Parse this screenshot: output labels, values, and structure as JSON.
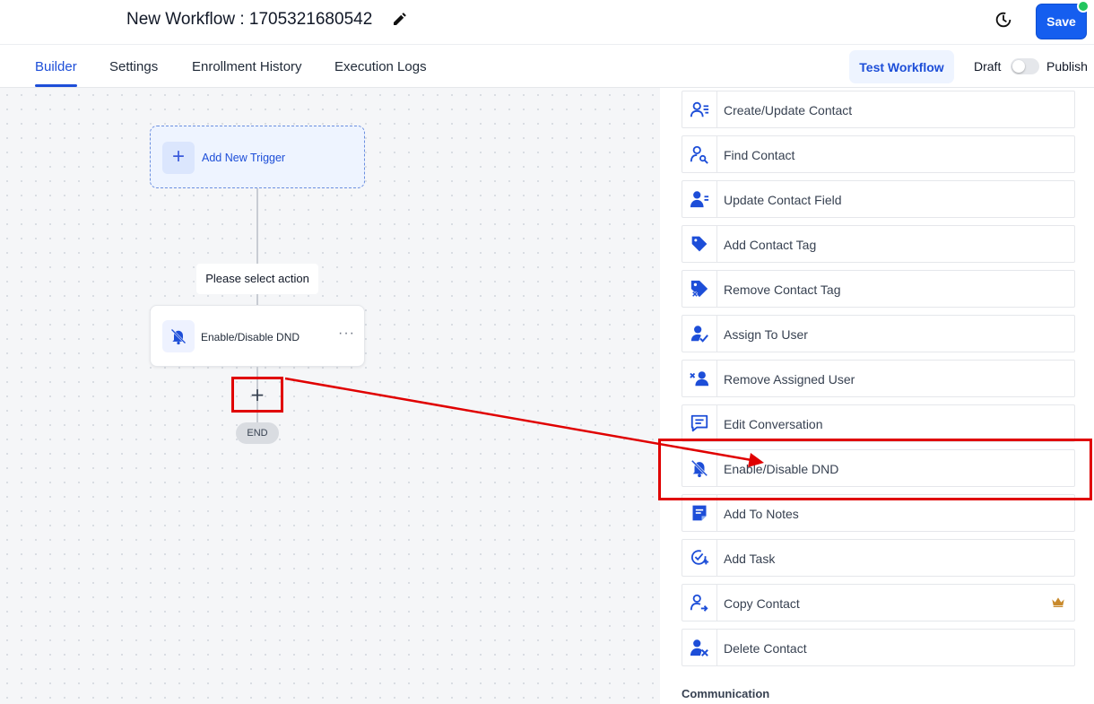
{
  "header": {
    "title": "New Workflow : 1705321680542",
    "save_label": "Save"
  },
  "tabs": {
    "builder": "Builder",
    "settings": "Settings",
    "enrollment_history": "Enrollment History",
    "execution_logs": "Execution Logs"
  },
  "toolbar": {
    "test_workflow": "Test Workflow",
    "draft": "Draft",
    "publish": "Publish"
  },
  "canvas": {
    "trigger_label": "Add New Trigger",
    "select_action": "Please select action",
    "action_label": "Enable/Disable DND",
    "end_label": "END"
  },
  "panel": {
    "items": [
      {
        "label": "Create/Update Contact",
        "icon": "contact-edit-icon"
      },
      {
        "label": "Find Contact",
        "icon": "find-contact-icon"
      },
      {
        "label": "Update Contact Field",
        "icon": "contact-field-icon"
      },
      {
        "label": "Add Contact Tag",
        "icon": "tag-icon"
      },
      {
        "label": "Remove Contact Tag",
        "icon": "tag-remove-icon"
      },
      {
        "label": "Assign To User",
        "icon": "assign-user-icon"
      },
      {
        "label": "Remove Assigned User",
        "icon": "remove-user-icon"
      },
      {
        "label": "Edit Conversation",
        "icon": "conversation-icon"
      },
      {
        "label": "Enable/Disable DND",
        "icon": "bell-off-icon"
      },
      {
        "label": "Add To Notes",
        "icon": "note-icon"
      },
      {
        "label": "Add Task",
        "icon": "task-icon"
      },
      {
        "label": "Copy Contact",
        "icon": "copy-contact-icon",
        "premium": true
      },
      {
        "label": "Delete Contact",
        "icon": "delete-contact-icon"
      }
    ],
    "section_title": "Communication"
  },
  "colors": {
    "primary": "#155eef",
    "icon_blue": "#1d4ed8",
    "annotation_red": "#e00000",
    "crown": "#c8892b"
  }
}
